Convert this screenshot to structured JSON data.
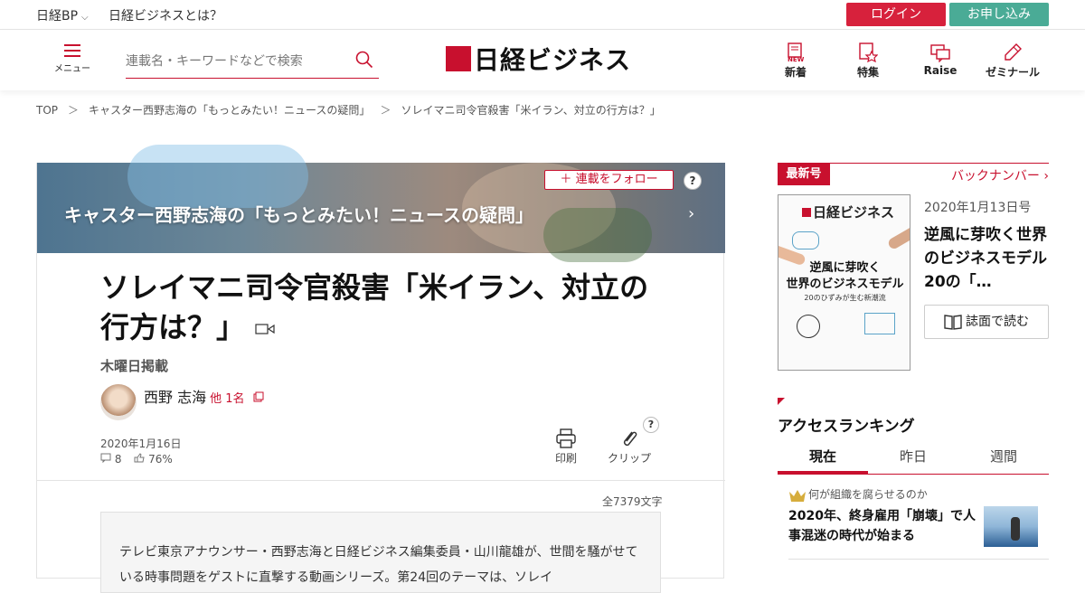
{
  "topbar": {
    "brand": "日経BP",
    "about": "日経ビジネスとは？",
    "login": "ログイン",
    "apply": "お申し込み",
    "colors": {
      "login": "#d7213c",
      "apply": "#4aab96"
    }
  },
  "header": {
    "menu_label": "メニュー",
    "search_placeholder": "連載名・キーワードなどで検索",
    "logo_text": "日経ビジネス",
    "nav": [
      {
        "label": "新着",
        "icon": "new-document-icon",
        "badge": "NEW"
      },
      {
        "label": "特集",
        "icon": "star-document-icon"
      },
      {
        "label": "Raise",
        "icon": "chat-bubbles-icon"
      },
      {
        "label": "ゼミナール",
        "icon": "pencil-icon"
      }
    ],
    "accent": "#c8102e"
  },
  "breadcrumb": {
    "items": [
      "TOP",
      "キャスター西野志海の「もっとみたい！ニュースの疑問」",
      "ソレイマニ司令官殺害「米イラン、対立の行方は？」"
    ],
    "separator": "＞"
  },
  "article": {
    "series_title": "キャスター西野志海の「もっとみたい！ニュースの疑問」",
    "follow_label": "連載をフォロー",
    "help": "?",
    "title": "ソレイマニ司令官殺害「米イラン、対立の行方は？」",
    "schedule": "木曜日掲載",
    "author": "西野 志海",
    "author_more": "他 1名",
    "date": "2020年1月16日",
    "comments": "8",
    "like_rate": "76%",
    "print_label": "印刷",
    "clip_label": "クリップ",
    "word_count": "全7379文字",
    "lead": "テレビ東京アナウンサー・西野志海と日経ビジネス編集委員・山川龍雄が、世間を騒がせている時事問題をゲストに直撃する動画シリーズ。第24回のテーマは、ソレイ"
  },
  "sidebar": {
    "latest_label": "最新号",
    "backnumber": "バックナンバー",
    "cover": {
      "logo": "日経ビジネス",
      "headline": "逆風に芽吹く\n世界のビジネスモデル",
      "sub": "20のひずみが生む新潮流"
    },
    "issue_date": "2020年1月13日号",
    "issue_title": "逆風に芽吹く世界のビジネスモデル　20の「…",
    "read_label": "誌面で読む",
    "ranking_title": "アクセスランキング",
    "tabs": [
      "現在",
      "昨日",
      "週間"
    ],
    "ranking": [
      {
        "category": "何が組織を腐らせるのか",
        "title": "2020年、終身雇用「崩壊」で人事混迷の時代が始まる"
      }
    ]
  }
}
